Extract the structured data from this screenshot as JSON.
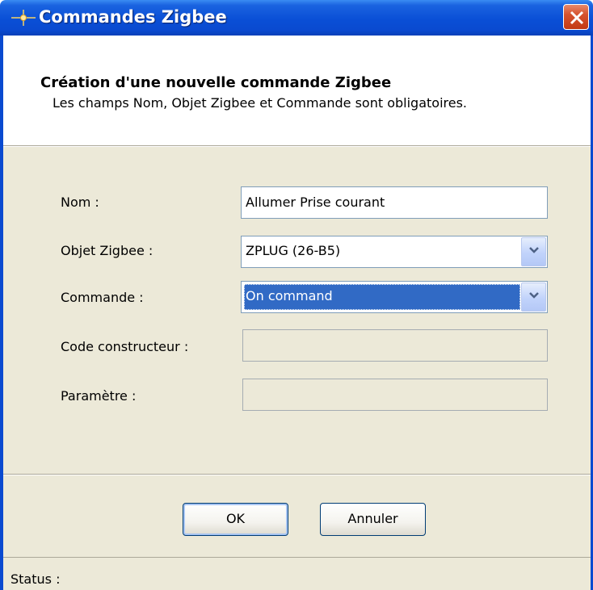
{
  "window": {
    "title": "Commandes Zigbee"
  },
  "header": {
    "title": "Création d'une nouvelle commande Zigbee",
    "subtitle": "Les champs Nom, Objet Zigbee et Commande sont obligatoires."
  },
  "form": {
    "nom": {
      "label": "Nom :",
      "value": "Allumer Prise courant"
    },
    "objet": {
      "label": "Objet Zigbee :",
      "value": "ZPLUG (26-B5)"
    },
    "commande": {
      "label": "Commande :",
      "value": "On command"
    },
    "code_constructeur": {
      "label": "Code constructeur :",
      "value": ""
    },
    "parametre": {
      "label": "Paramètre :",
      "value": ""
    }
  },
  "buttons": {
    "ok": "OK",
    "annuler": "Annuler"
  },
  "status": {
    "text": "Status :"
  },
  "colors": {
    "titlebar": "#0a4ad0",
    "dialog_bg": "#ece9d8",
    "selection": "#316ac5",
    "close_button": "#c23a14"
  },
  "icons": [
    "app-sparkle-icon",
    "close-icon",
    "chevron-down-icon"
  ]
}
